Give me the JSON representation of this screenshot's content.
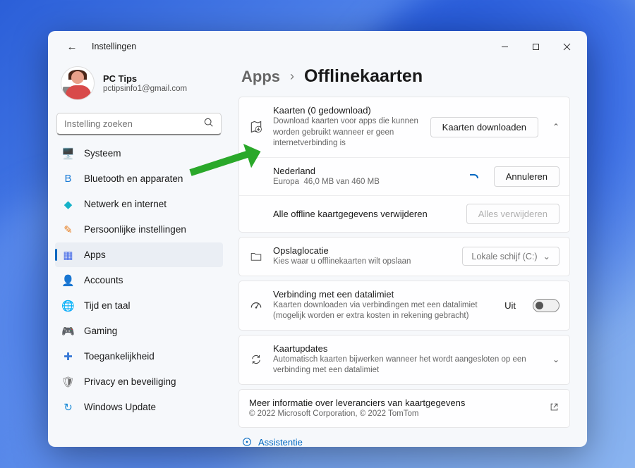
{
  "titlebar": {
    "title": "Instellingen"
  },
  "profile": {
    "name": "PC Tips",
    "email": "pctipsinfo1@gmail.com"
  },
  "search": {
    "placeholder": "Instelling zoeken"
  },
  "sidebar": {
    "items": [
      {
        "label": "Systeem",
        "icon": "🖥️",
        "color": "#1a7bd6"
      },
      {
        "label": "Bluetooth en apparaten",
        "icon": "B",
        "color": "#1a7bd6"
      },
      {
        "label": "Netwerk en internet",
        "icon": "◆",
        "color": "#15b2c8"
      },
      {
        "label": "Persoonlijke instellingen",
        "icon": "✎",
        "color": "#e67a1a"
      },
      {
        "label": "Apps",
        "icon": "▦",
        "color": "#4a6ee8"
      },
      {
        "label": "Accounts",
        "icon": "👤",
        "color": "#e68a2a"
      },
      {
        "label": "Tijd en taal",
        "icon": "🌐",
        "color": "#3a9ad6"
      },
      {
        "label": "Gaming",
        "icon": "🎮",
        "color": "#6a6a6a"
      },
      {
        "label": "Toegankelijkheid",
        "icon": "✚",
        "color": "#3a7ad6"
      },
      {
        "label": "Privacy en beveiliging",
        "icon": "🛡",
        "color": "#6a6a6a"
      },
      {
        "label": "Windows Update",
        "icon": "↻",
        "color": "#1a8ad6"
      }
    ]
  },
  "breadcrumb": {
    "parent": "Apps",
    "current": "Offlinekaarten"
  },
  "maps": {
    "title": "Kaarten (0 gedownload)",
    "subtitle": "Download kaarten voor apps die kunnen worden gebruikt wanneer er geen internetverbinding is",
    "download_btn": "Kaarten downloaden",
    "download": {
      "country": "Nederland",
      "region": "Europa",
      "progress": "46,0 MB van 460 MB",
      "cancel_btn": "Annuleren"
    },
    "delete_all_label": "Alle offline kaartgegevens verwijderen",
    "delete_all_btn": "Alles verwijderen"
  },
  "storage": {
    "title": "Opslaglocatie",
    "subtitle": "Kies waar u offlinekaarten wilt opslaan",
    "value": "Lokale schijf (C:)"
  },
  "metered": {
    "title": "Verbinding met een datalimiet",
    "subtitle": "Kaarten downloaden via verbindingen met een datalimiet (mogelijk worden er extra kosten in rekening gebracht)",
    "state": "Uit"
  },
  "updates": {
    "title": "Kaartupdates",
    "subtitle": "Automatisch kaarten bijwerken wanneer het wordt aangesloten op een verbinding met een datalimiet"
  },
  "footer": {
    "title": "Meer informatie over leveranciers van kaartgegevens",
    "copyright": "© 2022 Microsoft Corporation, © 2022 TomTom"
  },
  "assist_cut": "Assistentie"
}
